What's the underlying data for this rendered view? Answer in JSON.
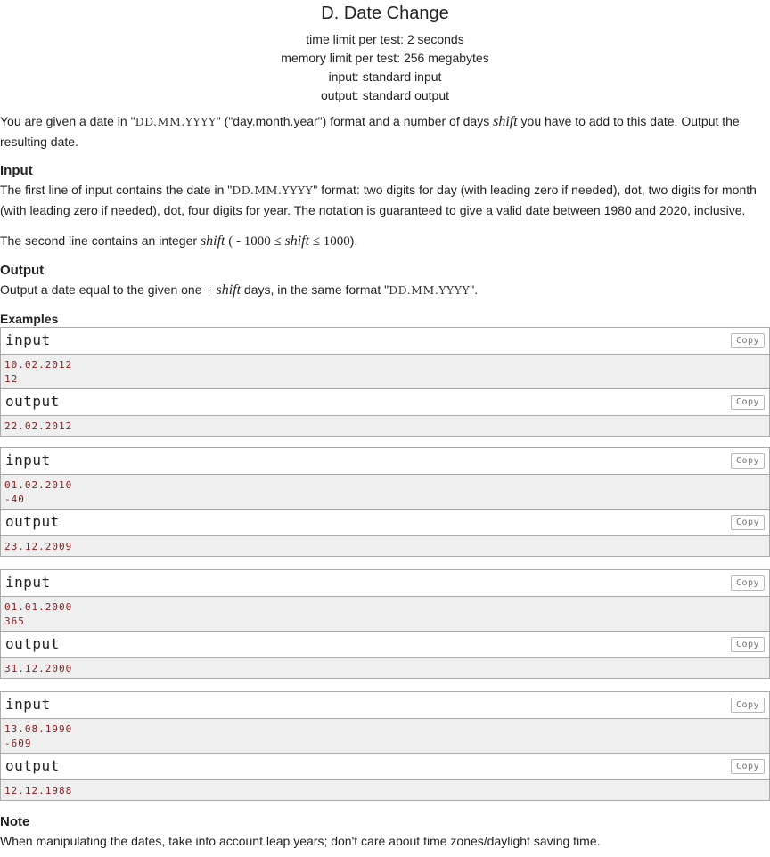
{
  "problem": {
    "title": "D. Date Change",
    "limits": [
      "time limit per test: 2 seconds",
      "memory limit per test: 256 megabytes",
      "input: standard input",
      "output: standard output"
    ]
  },
  "statement": {
    "p1_a": "You are given a date in \"",
    "p1_fmt": "DD.MM.YYYY",
    "p1_b": "\" (\"day.month.year\") format and a number of days ",
    "p1_var": "shift",
    "p1_c": " you have to add to this date. Output the resulting date."
  },
  "input_section": {
    "heading": "Input",
    "p1_a": "The first line of input contains the date in \"",
    "p1_fmt": "DD.MM.YYYY",
    "p1_b": "\" format: two digits for day (with leading zero if needed), dot, two digits for month (with leading zero if needed), dot, four digits for year. The notation is guaranteed to give a valid date between 1980 and 2020, inclusive.",
    "p2_a": "The second line contains an integer ",
    "p2_var": "shift",
    "p2_open": " (",
    "p2_min": " - 1000 ≤ ",
    "p2_var2": "shift",
    "p2_max": " ≤ 1000",
    "p2_close": ")."
  },
  "output_section": {
    "heading": "Output",
    "p1_a": "Output a date equal to the given one + ",
    "p1_var": "shift",
    "p1_b": " days, in the same format \"",
    "p1_fmt": "DD.MM.YYYY",
    "p1_c": "\"."
  },
  "examples": {
    "heading": "Examples",
    "input_label": "input",
    "output_label": "output",
    "copy_label": "Copy",
    "items": [
      {
        "input": [
          "10.02.2012",
          "12"
        ],
        "output": [
          "22.02.2012"
        ]
      },
      {
        "input": [
          "01.02.2010",
          "-40"
        ],
        "output": [
          "23.12.2009"
        ]
      },
      {
        "input": [
          "01.01.2000",
          "365"
        ],
        "output": [
          "31.12.2000"
        ]
      },
      {
        "input": [
          "13.08.1990",
          "-609"
        ],
        "output": [
          "12.12.1988"
        ]
      }
    ]
  },
  "note": {
    "heading": "Note",
    "text": "When manipulating the dates, take into account leap years; don't care about time zones/daylight saving time."
  }
}
